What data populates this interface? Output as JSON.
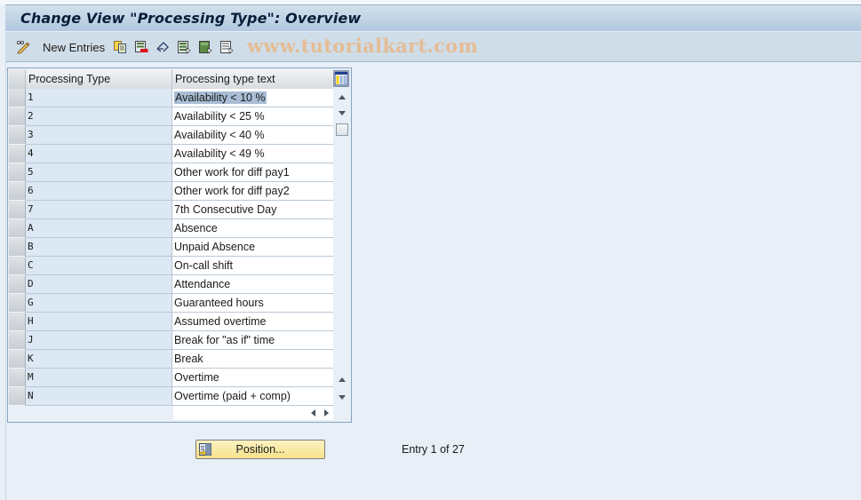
{
  "title": "Change View \"Processing Type\": Overview",
  "toolbar": {
    "items": [
      {
        "icon": "pencil-glasses-icon",
        "label": "Display/Change"
      },
      {
        "label": "New Entries"
      },
      {
        "icon": "copy-as-icon"
      },
      {
        "icon": "delete-icon"
      },
      {
        "icon": "undo-change-icon"
      },
      {
        "icon": "select-all-icon"
      },
      {
        "icon": "select-block-icon"
      },
      {
        "icon": "deselect-all-icon"
      }
    ],
    "new_entries_label": "New Entries",
    "watermark": "www.tutorialkart.com"
  },
  "table": {
    "columns": [
      "Processing Type",
      "Processing type text"
    ],
    "rows": [
      {
        "key": "1",
        "text": "Availability < 10 %",
        "selected": true
      },
      {
        "key": "2",
        "text": "Availability < 25 %"
      },
      {
        "key": "3",
        "text": "Availability < 40 %"
      },
      {
        "key": "4",
        "text": "Availability < 49 %"
      },
      {
        "key": "5",
        "text": "Other work for diff pay1"
      },
      {
        "key": "6",
        "text": "Other work for diff pay2"
      },
      {
        "key": "7",
        "text": "7th Consecutive Day"
      },
      {
        "key": "A",
        "text": "Absence"
      },
      {
        "key": "B",
        "text": "Unpaid Absence"
      },
      {
        "key": "C",
        "text": "On-call shift"
      },
      {
        "key": "D",
        "text": "Attendance"
      },
      {
        "key": "G",
        "text": "Guaranteed hours"
      },
      {
        "key": "H",
        "text": "Assumed overtime"
      },
      {
        "key": "J",
        "text": "Break for \"as if\" time"
      },
      {
        "key": "K",
        "text": "Break"
      },
      {
        "key": "M",
        "text": "Overtime"
      },
      {
        "key": "N",
        "text": "Overtime (paid + comp)"
      }
    ]
  },
  "footer": {
    "position_button": "Position...",
    "entry_info": "Entry 1 of 27"
  },
  "colors": {
    "title_bar": "#b2c8df",
    "toolbar": "#cfdde8",
    "key_cell": "#dce8f3",
    "selection": "#a9bed5",
    "position_button": "#f6e18c",
    "watermark": "#e7b98c"
  }
}
